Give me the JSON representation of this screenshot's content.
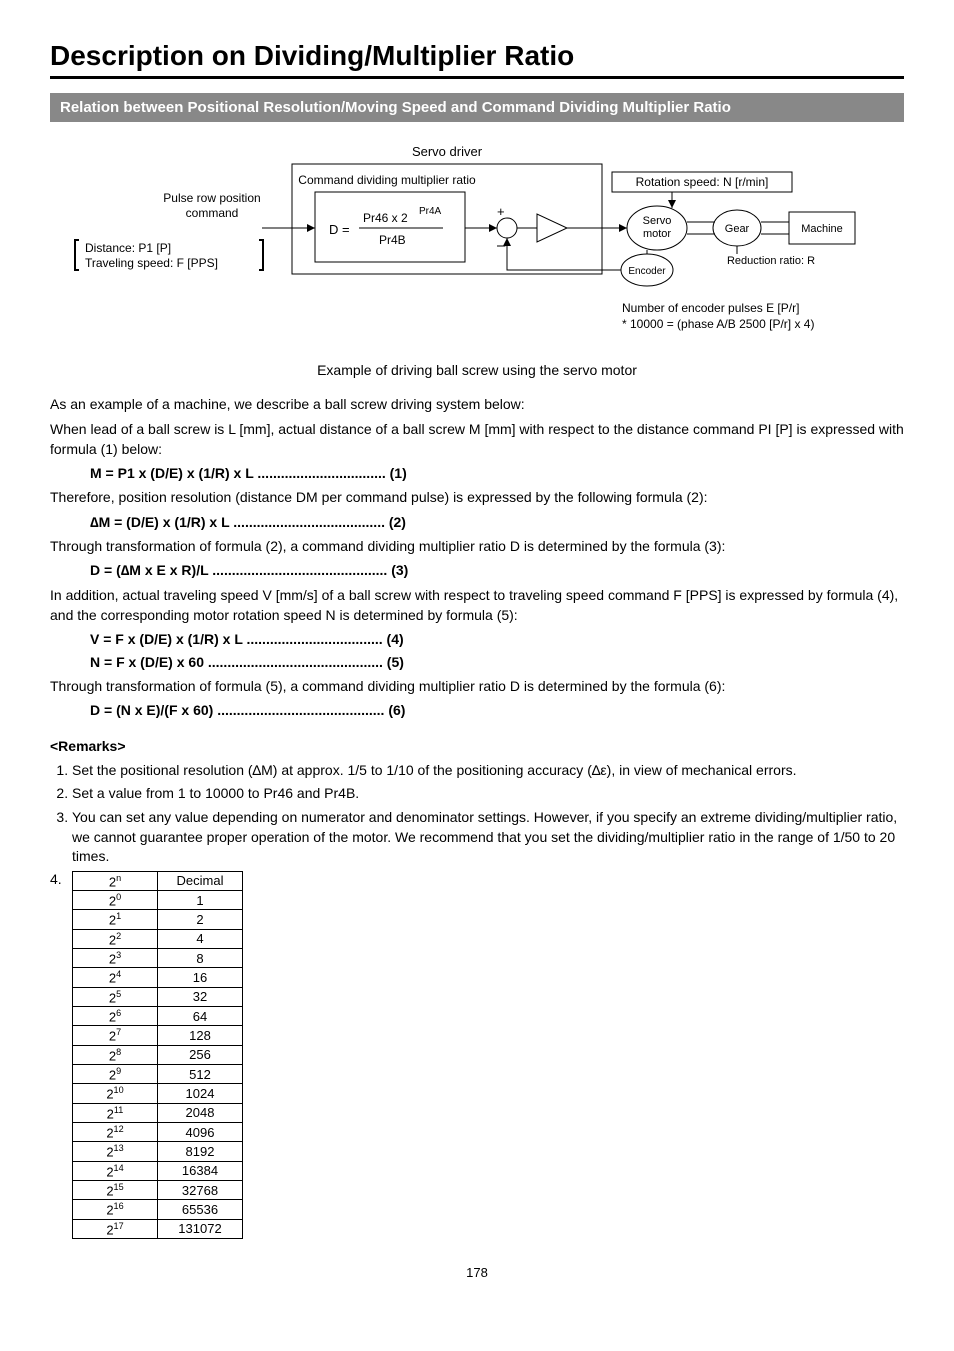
{
  "title": "Description on Dividing/Multiplier Ratio",
  "section_bar": "Relation between Positional Resolution/Moving Speed and Command Dividing Multiplier Ratio",
  "diagram": {
    "servo_driver": "Servo driver",
    "cmd_ratio_box": "Command dividing multiplier ratio",
    "pulse_row_1": "Pulse row position",
    "pulse_row_2": "command",
    "bracket_1": "Distance: P1 [P]",
    "bracket_2": "Traveling speed: F [PPS]",
    "d_eq": "D =",
    "d_num": "Pr46 x 2",
    "d_exp": "Pr4A",
    "d_den": "Pr4B",
    "plus": "+",
    "minus": "–",
    "rotation": "Rotation speed: N [r/min]",
    "servo_motor_1": "Servo",
    "servo_motor_2": "motor",
    "gear": "Gear",
    "machine": "Machine",
    "reduction": "Reduction ratio: R",
    "encoder": "Encoder",
    "enc_line1": "Number of encoder pulses E [P/r]",
    "enc_line2": "* 10000 = (phase A/B 2500 [P/r] x 4)"
  },
  "caption": "Example of driving ball screw using the servo motor",
  "para1": "As an example of a machine, we describe a ball screw driving system below:",
  "para2": "When lead of a ball screw is L [mm], actual distance of a ball screw M [mm] with respect to the distance command PI [P] is expressed with formula (1) below:",
  "formula1": "M = P1 x (D/E) x (1/R) x L ................................. (1)",
  "para3": "Therefore, position resolution (distance DM per command pulse) is expressed by the following formula (2):",
  "formula2": "∆M = (D/E) x (1/R) x L ....................................... (2)",
  "para4": "Through transformation of formula (2), a command dividing multiplier ratio D is determined by the formula (3):",
  "formula3": "D = (∆M x E x R)/L ............................................. (3)",
  "para5": "In addition, actual traveling speed V [mm/s] of a ball screw with respect to traveling speed command F [PPS] is expressed by formula (4), and the corresponding motor rotation speed N is determined by formula (5):",
  "formula4": "V = F x (D/E) x (1/R) x L ................................... (4)",
  "formula5": "N = F x (D/E) x 60 ............................................. (5)",
  "para6": "Through transformation of formula (5), a command dividing multiplier ratio D is determined by the formula (6):",
  "formula6": "D = (N x E)/(F x 60) ........................................... (6)",
  "remarks_heading": "<Remarks>",
  "remarks": [
    "Set the positional resolution (∆M) at approx. 1/5 to 1/10 of the positioning accuracy (∆ε), in view of mechanical errors.",
    "Set a value from 1 to 10000 to Pr46 and Pr4B.",
    "You can set any value depending on numerator and denominator settings.  However, if you specify an extreme dividing/multiplier ratio, we cannot guarantee proper operation of the motor.  We recommend that you set the dividing/multiplier ratio in the range of 1/50 to 20 times."
  ],
  "pow_table": {
    "head_l": "2",
    "head_l_sup": "n",
    "head_r": "Decimal",
    "rows": [
      {
        "exp": "0",
        "dec": "1"
      },
      {
        "exp": "1",
        "dec": "2"
      },
      {
        "exp": "2",
        "dec": "4"
      },
      {
        "exp": "3",
        "dec": "8"
      },
      {
        "exp": "4",
        "dec": "16"
      },
      {
        "exp": "5",
        "dec": "32"
      },
      {
        "exp": "6",
        "dec": "64"
      },
      {
        "exp": "7",
        "dec": "128"
      },
      {
        "exp": "8",
        "dec": "256"
      },
      {
        "exp": "9",
        "dec": "512"
      },
      {
        "exp": "10",
        "dec": "1024"
      },
      {
        "exp": "11",
        "dec": "2048"
      },
      {
        "exp": "12",
        "dec": "4096"
      },
      {
        "exp": "13",
        "dec": "8192"
      },
      {
        "exp": "14",
        "dec": "16384"
      },
      {
        "exp": "15",
        "dec": "32768"
      },
      {
        "exp": "16",
        "dec": "65536"
      },
      {
        "exp": "17",
        "dec": "131072"
      }
    ]
  },
  "page_number": "178"
}
